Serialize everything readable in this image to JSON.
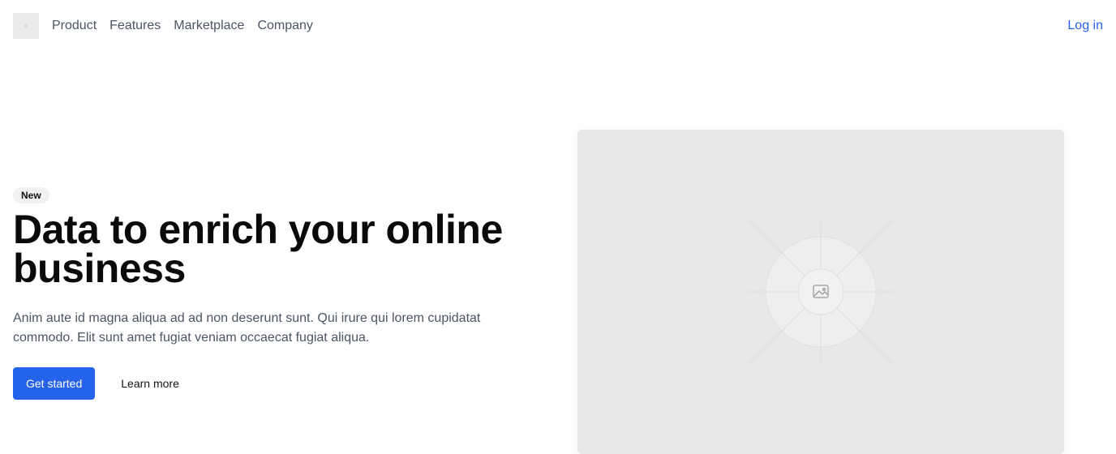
{
  "header": {
    "nav": [
      "Product",
      "Features",
      "Marketplace",
      "Company"
    ],
    "login_label": "Log in"
  },
  "hero": {
    "badge": "New",
    "title": "Data to enrich your online business",
    "subtitle": "Anim aute id magna aliqua ad ad non deserunt sunt. Qui irure qui lorem cupidatat commodo. Elit sunt amet fugiat veniam occaecat fugiat aliqua.",
    "primary_cta": "Get started",
    "secondary_cta": "Learn more"
  },
  "colors": {
    "accent": "#2563eb",
    "placeholder": "#e8e8e8"
  },
  "icons": {
    "logo": "logo-placeholder",
    "image": "image-placeholder-icon"
  }
}
